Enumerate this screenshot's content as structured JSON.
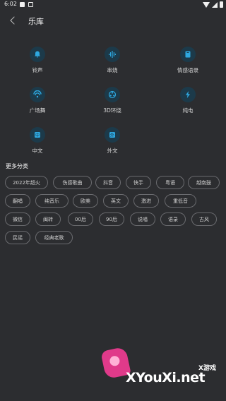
{
  "status": {
    "time": "6:02"
  },
  "header": {
    "title": "乐库"
  },
  "categories": [
    {
      "label": "铃声",
      "icon": "bell-icon"
    },
    {
      "label": "串烧",
      "icon": "waveform-icon"
    },
    {
      "label": "情感语录",
      "icon": "book-icon"
    },
    {
      "label": "广场舞",
      "icon": "dance-icon"
    },
    {
      "label": "3D环绕",
      "icon": "surround-icon"
    },
    {
      "label": "纯电",
      "icon": "lightning-icon"
    },
    {
      "label": "中文",
      "icon": "chinese-icon",
      "glyph": "中"
    },
    {
      "label": "外文",
      "icon": "foreign-icon",
      "glyph": "外"
    }
  ],
  "more": {
    "title": "更多分类",
    "tags": [
      "2022年超火",
      "伤感歌曲",
      "抖音",
      "快手",
      "粤语",
      "越南鼓",
      "翻唱",
      "纯音乐",
      "欧美",
      "英文",
      "激进",
      "重低音",
      "微信",
      "闽转",
      "00后",
      "90后",
      "说唱",
      "语录",
      "古风",
      "民谣",
      "经典老歌"
    ]
  },
  "watermark": {
    "brand": "XYouXi.net",
    "sub": "X游戏"
  },
  "colors": {
    "background": "#2c2d30",
    "accent": "#2ea8e0",
    "icon_bg": "#1c3a4a",
    "tag_border": "#6a6b6f"
  }
}
